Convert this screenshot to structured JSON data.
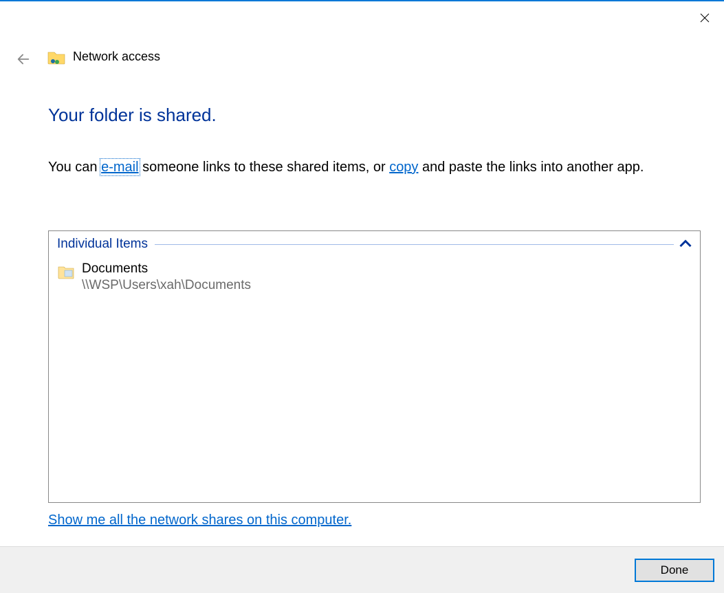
{
  "window": {
    "title": "Network access"
  },
  "main": {
    "heading": "Your folder is shared.",
    "desc_prefix": "You can ",
    "email_link": "e-mail",
    "desc_mid": " someone links to these shared items, or ",
    "copy_link": "copy",
    "desc_suffix": " and paste the links into another app."
  },
  "items": {
    "group_label": "Individual Items",
    "list": [
      {
        "name": "Documents",
        "path": "\\\\WSP\\Users\\xah\\Documents"
      }
    ]
  },
  "bottom_link": "Show me all the network shares on this computer.",
  "footer": {
    "done_label": "Done"
  }
}
